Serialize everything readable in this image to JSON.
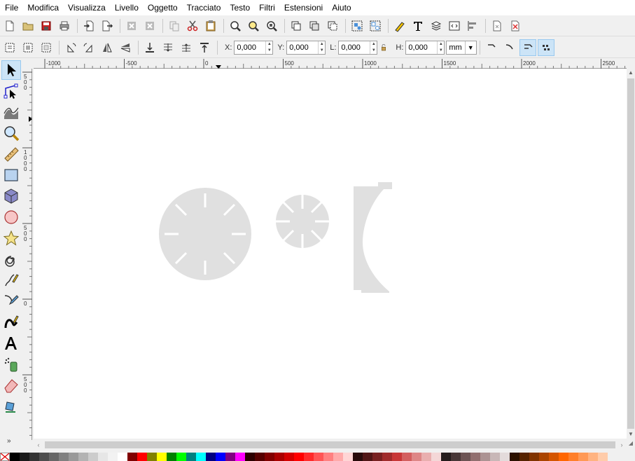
{
  "menu": [
    "File",
    "Modifica",
    "Visualizza",
    "Livello",
    "Oggetto",
    "Tracciato",
    "Testo",
    "Filtri",
    "Estensioni",
    "Aiuto"
  ],
  "command_bar": {
    "icons": [
      "new-document-icon",
      "open-icon",
      "save-icon",
      "print-icon",
      "import-icon",
      "export-icon",
      "undo-icon",
      "redo-icon",
      "copy-icon",
      "cut-icon",
      "paste-icon",
      "zoom-selection-icon",
      "zoom-drawing-icon",
      "zoom-page-icon",
      "duplicate-icon",
      "clone-icon",
      "unlink-clone-icon",
      "group-icon",
      "ungroup-icon",
      "fill-stroke-icon",
      "text-font-icon",
      "layers-icon",
      "xml-editor-icon",
      "align-distribute-icon",
      "document-properties-icon",
      "preferences-icon"
    ]
  },
  "controls": {
    "x_label": "X:",
    "x_value": "0,000",
    "y_label": "Y:",
    "y_value": "0,000",
    "w_label": "L:",
    "w_value": "0,000",
    "h_label": "H:",
    "h_value": "0,000",
    "unit": "mm"
  },
  "hruler": {
    "labels": [
      "-1000",
      "-500",
      "0",
      "500",
      "1000",
      "1500",
      "2000",
      "2500"
    ]
  },
  "vruler": {
    "labels": [
      "500",
      "1000",
      "500",
      "0",
      "500"
    ]
  },
  "toolbox": {
    "tools": [
      "selector-tool-icon",
      "node-tool-icon",
      "tweak-tool-icon",
      "zoom-tool-icon",
      "measure-tool-icon",
      "rectangle-tool-icon",
      "box3d-tool-icon",
      "ellipse-tool-icon",
      "star-tool-icon",
      "spiral-tool-icon",
      "pencil-tool-icon",
      "pen-tool-icon",
      "calligraphy-tool-icon",
      "text-tool-icon",
      "spray-tool-icon",
      "eraser-tool-icon",
      "paint-bucket-tool-icon"
    ],
    "more": "»"
  },
  "palette": [
    "#800000",
    "#ff0000",
    "#808000",
    "#ffff00",
    "#008000",
    "#00ff00",
    "#008080",
    "#00ffff",
    "#000080",
    "#0000ff",
    "#800080",
    "#ff00ff",
    "#2b0000",
    "#550000",
    "#800000",
    "#aa0000",
    "#d40000",
    "#ff0000",
    "#ff2a2a",
    "#ff5555",
    "#ff8080",
    "#ffaaaa",
    "#ffd5d5",
    "#280b0b",
    "#501616",
    "#782121",
    "#a02c2c",
    "#c83737",
    "#d35f5f",
    "#de8787",
    "#e9afaf",
    "#f4d7d7",
    "#241c1c",
    "#483737",
    "#6c5353",
    "#916f6f",
    "#ac9393",
    "#c8b7b7",
    "#e3dbdb",
    "#2b1100",
    "#552200",
    "#803300",
    "#aa4400",
    "#d45500",
    "#ff6600",
    "#ff7f2a",
    "#ff9955",
    "#ffb380",
    "#ffccaa"
  ],
  "grays": [
    "#000000",
    "#1a1a1a",
    "#333333",
    "#4d4d4d",
    "#666666",
    "#808080",
    "#999999",
    "#b3b3b3",
    "#cccccc",
    "#e6e6e6",
    "#f2f2f2",
    "#ffffff"
  ]
}
